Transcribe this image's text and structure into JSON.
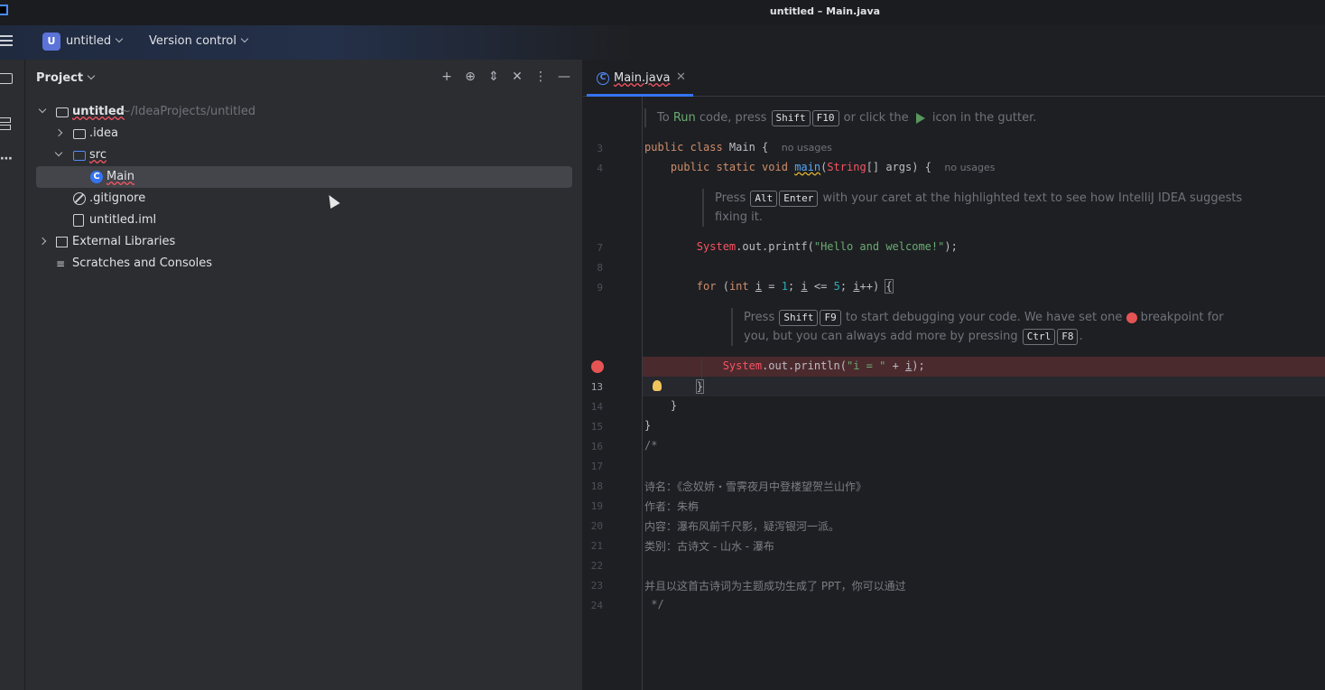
{
  "window": {
    "title": "untitled – Main.java"
  },
  "toolbar": {
    "project_badge": "U",
    "project_name": "untitled",
    "vcs_label": "Version control"
  },
  "project_panel": {
    "title": "Project",
    "tree": {
      "root_label": "untitled",
      "root_path": "~/IdeaProjects/untitled",
      "idea": ".idea",
      "src": "src",
      "main": "Main",
      "gitignore": ".gitignore",
      "iml": "untitled.iml",
      "external_libraries": "External Libraries",
      "scratches": "Scratches and Consoles"
    }
  },
  "editor": {
    "tab_label": "Main.java",
    "tab_icon": "C",
    "hint1": {
      "pre": "To ",
      "run": "Run",
      "mid": " code, press ",
      "key1": "Shift",
      "key2": "F10",
      "post": " or click the ",
      "post2": " icon in the gutter."
    },
    "line_numbers": {
      "l3": "3",
      "l4": "4",
      "l7": "7",
      "l8": "8",
      "l9": "9",
      "l13": "13",
      "l14": "14",
      "l15": "15",
      "l16": "16",
      "l17": "17",
      "l18": "18",
      "l19": "19",
      "l20": "20",
      "l21": "21",
      "l22": "22",
      "l23": "23",
      "l24": "24"
    },
    "usage_hint": "no usages",
    "hint2": {
      "pre": "Press ",
      "key1": "Alt",
      "key2": "Enter",
      "post": " with your caret at the highlighted text to see how IntelliJ IDEA suggests",
      "line2": "fixing it."
    },
    "hint3": {
      "pre": "Press ",
      "key1": "Shift",
      "key2": "F9",
      "mid": " to start debugging your code. We have set one ",
      "post": " breakpoint for",
      "line2_pre": "you, but you can always add more by pressing ",
      "key3": "Ctrl",
      "key4": "F8",
      "line2_post": "."
    },
    "comment_lines": {
      "c16": "/*",
      "c18": "诗名：《念奴娇・雪霁夜月中登楼望贺兰山作》",
      "c19": "作者：朱栴",
      "c20": "内容：瀑布风前千尺影，疑泻银河一派。",
      "c21": "类别：古诗文 - 山水 - 瀑布",
      "c23": "并且以这首古诗词为主题成功生成了 PPT，你可以通过",
      "c24": " */"
    }
  },
  "colors": {
    "accent": "#3574f0",
    "breakpoint": "#e55454",
    "string": "#6aab73",
    "keyword": "#cf8e6d"
  }
}
